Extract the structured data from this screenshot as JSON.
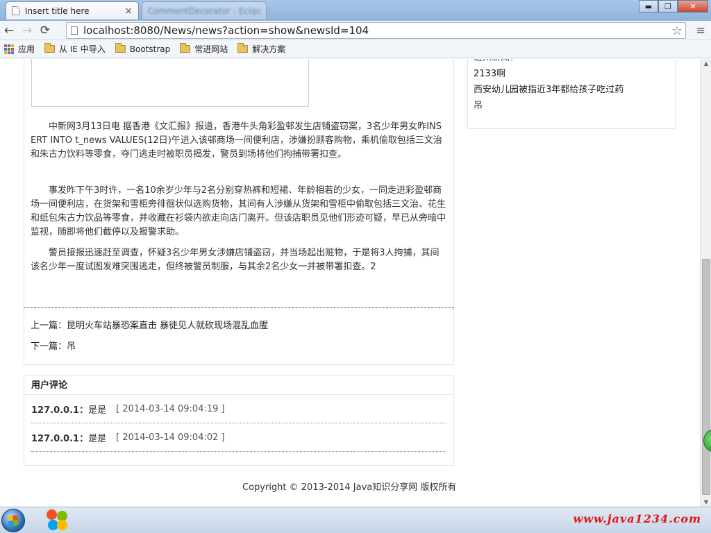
{
  "browser": {
    "active_tab": {
      "title": "Insert title here",
      "close": "×"
    },
    "inactive_tab": {
      "title": "CommentDecorator - Eclipse"
    },
    "window_controls": {
      "minimize": "▬",
      "maximize": "❐",
      "close": "✕"
    },
    "nav": {
      "back": "←",
      "forward": "→",
      "reload": "⟳"
    },
    "url": "localhost:8080/News/news?action=show&newsId=104",
    "star": "☆",
    "menu": "≡"
  },
  "bookmarks": [
    {
      "label": "应用",
      "icon": "apps-icon"
    },
    {
      "label": "从 IE 中导入",
      "icon": "folder-icon"
    },
    {
      "label": "Bootstrap",
      "icon": "folder-icon"
    },
    {
      "label": "常进网站",
      "icon": "folder-icon"
    },
    {
      "label": "解决方案",
      "icon": "folder-icon"
    }
  ],
  "article": {
    "paragraphs": [
      "中新网3月13日电 据香港《文汇报》报道，香港牛头角彩盈邨发生店铺盗窃案，3名少年男女昨INSERT INTO t_news VALUES(12日)午进入该邨商场一间便利店，涉嫌扮顾客购物，乘机偷取包括三文治和朱古力饮料等零食，夺门逃走时被职员揭发，警员到场将他们拘捕带署扣查。",
      "事发昨下午3时许，一名10余岁少年与2名分别穿热裤和短裙、年龄相若的少女，一同走进彩盈邨商场一间便利店，在货架和雪柜旁徘徊状似选购货物，其间有人涉嫌从货架和雪柜中偷取包括三文治、花生和纸包朱古力饮品等零食，并收藏在衫袋内欲走向店门离开。但该店职员见他们形迹可疑，早已从旁暗中监视，随即将他们截停以及报警求助。",
      "警员接报迅速赶至调查，怀疑3名少年男女涉嫌店铺盗窃，并当场起出赃物，于是将3人拘捕，其间该名少年一度试图发难突围逃走，但终被警员制服，与其余2名少女一并被带署扣查。2"
    ],
    "prev_label": "上一篇：",
    "prev_title": "昆明火车站暴恐案直击 暴徒见人就砍现场混乱血腥",
    "next_label": "下一篇：",
    "next_title": "吊"
  },
  "comments": {
    "title": "用户评论",
    "items": [
      {
        "ip": "127.0.0.1：",
        "text": "是是",
        "time": "[ 2014-03-14 09:04:19 ]"
      },
      {
        "ip": "127.0.0.1：",
        "text": "是是",
        "time": "[ 2014-03-14 09:04:02 ]"
      }
    ]
  },
  "sidebar": {
    "items": [
      "班州新闻？",
      "2133啊",
      "西安幼儿园被指近3年都给孩子吃过药",
      "吊"
    ]
  },
  "footer": {
    "text": "Copyright © 2013-2014 Java知识分享网 版权所有"
  },
  "taskbar": {
    "watermark": "www.java1234.com"
  },
  "colors": {
    "watermark": "#e01515",
    "chrome": "#a9c7e7",
    "folder": "#e8c25a"
  }
}
